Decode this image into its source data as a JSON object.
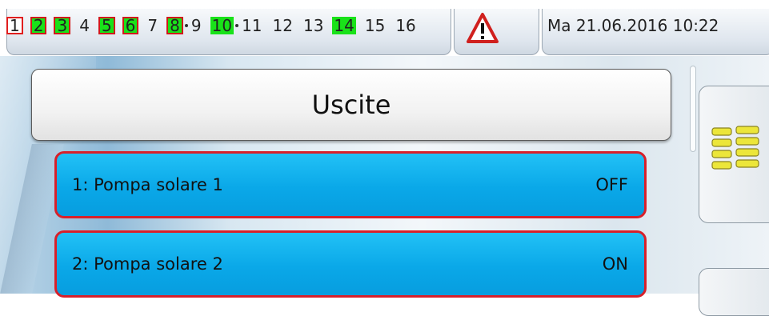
{
  "status_bar": {
    "outputs": [
      {
        "num": "1",
        "style": "red"
      },
      {
        "num": "2",
        "style": "green"
      },
      {
        "num": "3",
        "style": "green"
      },
      {
        "num": "4",
        "style": "plain"
      },
      {
        "num": "5",
        "style": "green"
      },
      {
        "num": "6",
        "style": "green"
      },
      {
        "num": "7",
        "style": "plain"
      },
      {
        "num": "8",
        "style": "green",
        "dot_after": true
      },
      {
        "num": "9",
        "style": "plain"
      },
      {
        "num": "10",
        "style": "greenonly",
        "dot_after": true
      },
      {
        "num": "11",
        "style": "plain"
      },
      {
        "num": "12",
        "style": "plain"
      },
      {
        "num": "13",
        "style": "plain"
      },
      {
        "num": "14",
        "style": "greenonly"
      },
      {
        "num": "15",
        "style": "plain"
      },
      {
        "num": "16",
        "style": "plain"
      }
    ],
    "warning_icon": "warning-triangle-icon",
    "datetime": "Ma 21.06.2016 10:22"
  },
  "title": "Uscite",
  "outputs_list": [
    {
      "label": "1: Pompa solare 1",
      "state": "OFF"
    },
    {
      "label": "2: Pompa solare 2",
      "state": "ON"
    }
  ],
  "side_menu_icon": "menu-grid-icon",
  "colors": {
    "row_blue": "#0aa8e8",
    "row_border_red": "#d8202a",
    "status_green": "#19e219",
    "status_red": "#e01e1e"
  }
}
